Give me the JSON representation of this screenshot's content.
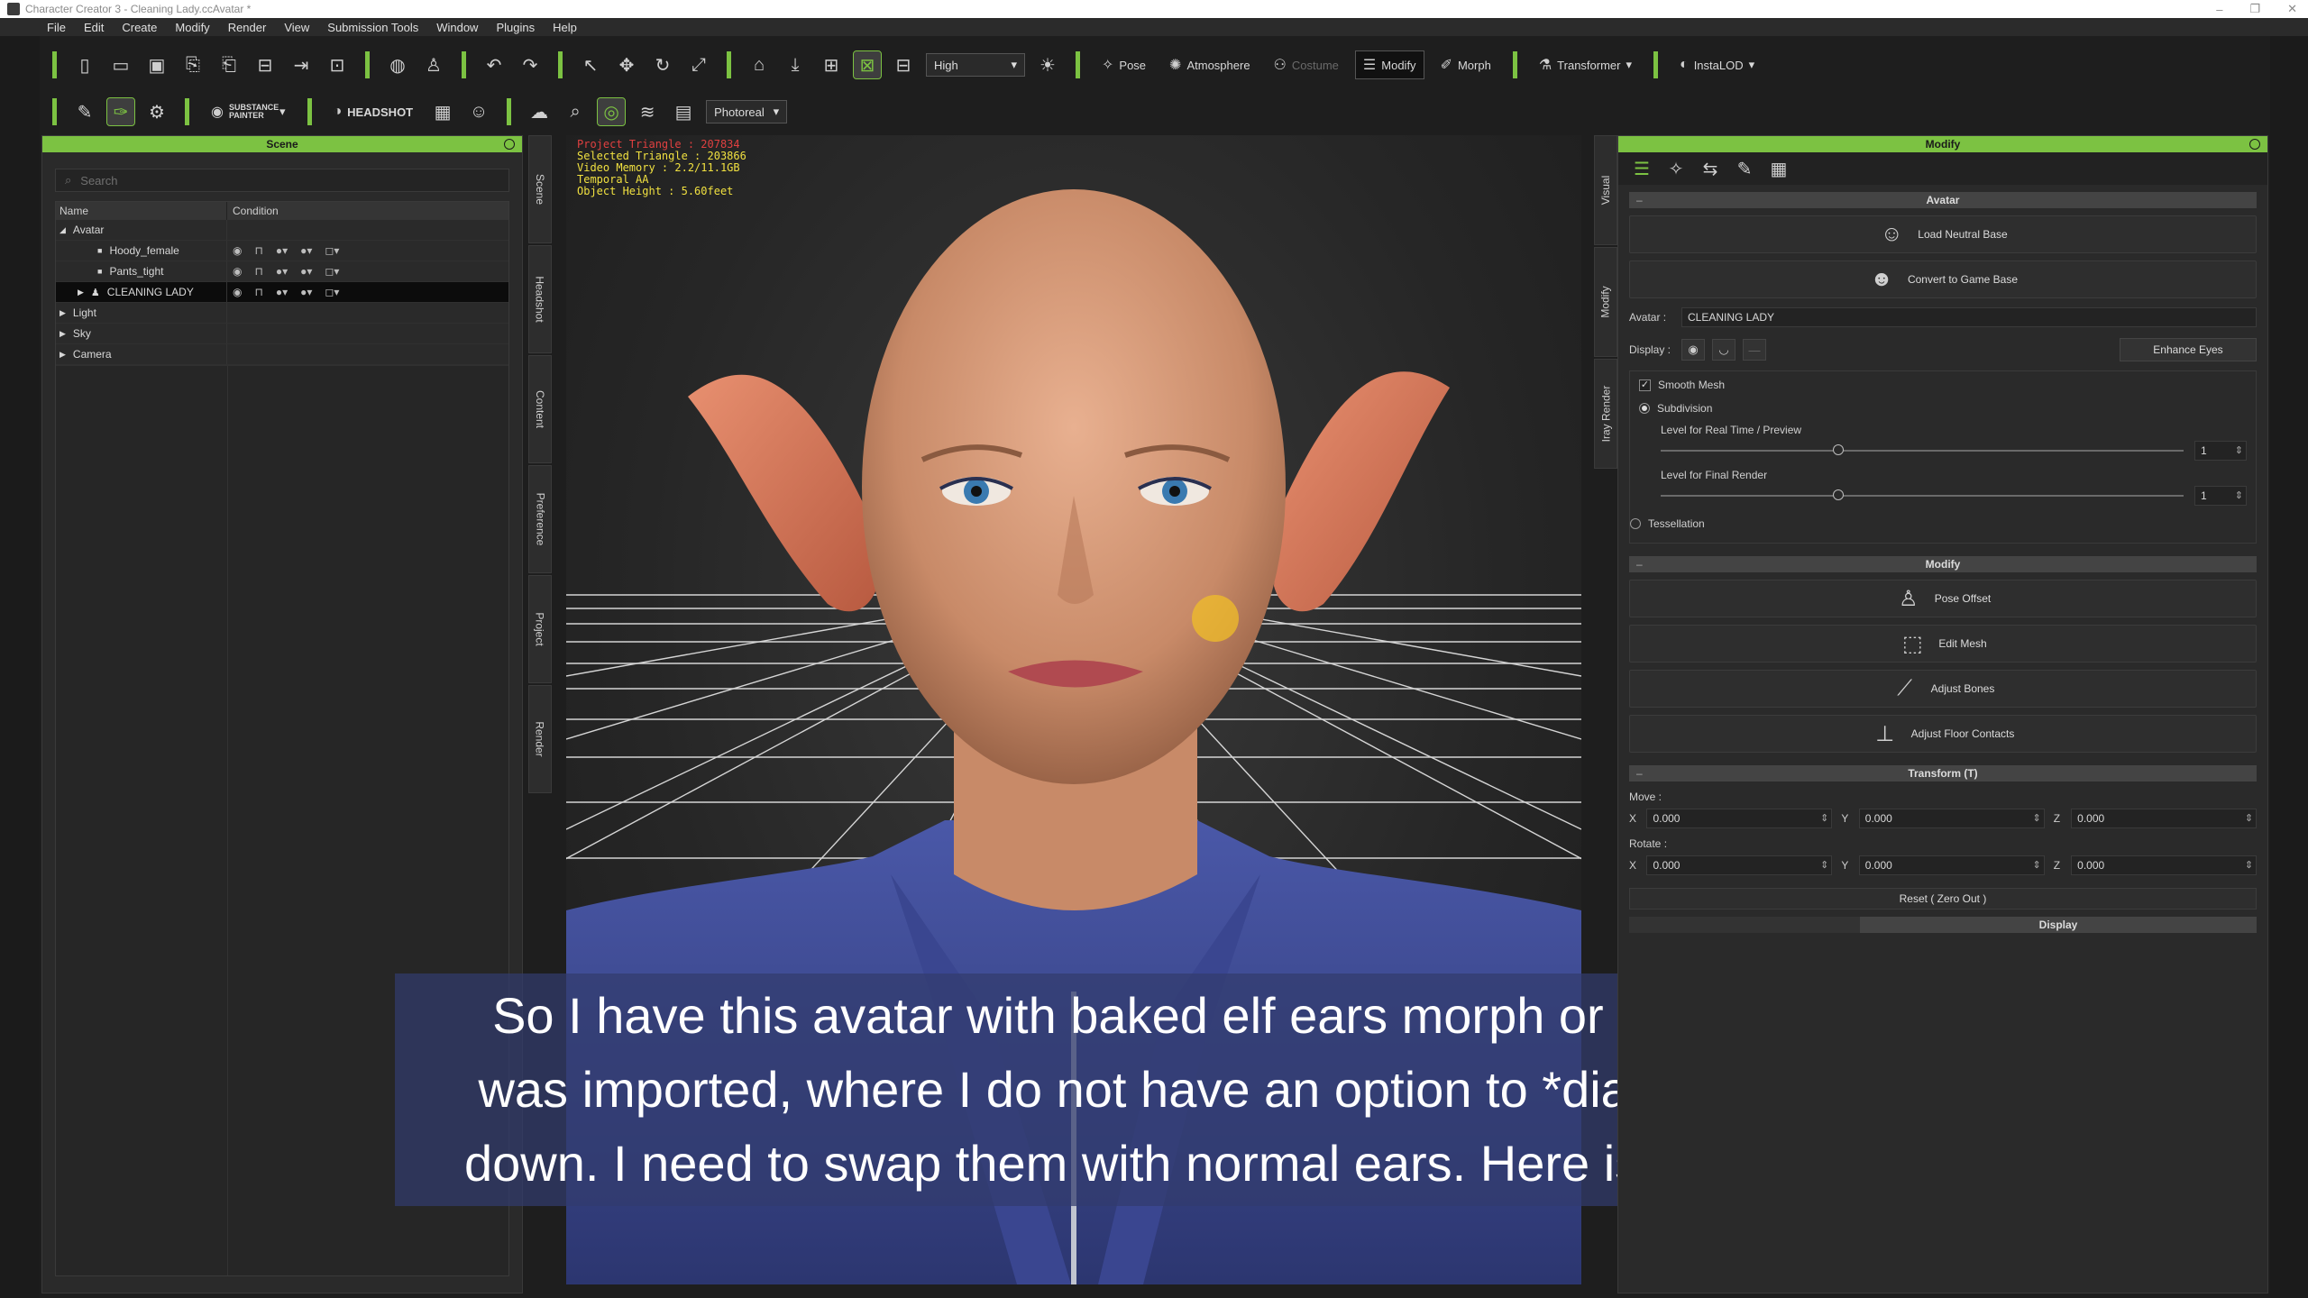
{
  "window": {
    "title": "Character Creator 3 - Cleaning Lady.ccAvatar *"
  },
  "menu": [
    "File",
    "Edit",
    "Create",
    "Modify",
    "Render",
    "View",
    "Submission Tools",
    "Window",
    "Plugins",
    "Help"
  ],
  "toolbar": {
    "quality_select": "High",
    "pose_label": "Pose",
    "atmosphere_label": "Atmosphere",
    "costume_label": "Costume",
    "modify_label": "Modify",
    "morph_label": "Morph",
    "transformer_label": "Transformer",
    "instalod_label": "InstaLOD",
    "substance_label": "SUBSTANCE PAINTER",
    "headshot_label": "HEADSHOT",
    "render_select": "Photoreal"
  },
  "scene": {
    "title": "Scene",
    "search_placeholder": "Search",
    "col_name": "Name",
    "col_condition": "Condition",
    "items": [
      {
        "label": "Avatar"
      },
      {
        "label": "Hoody_female"
      },
      {
        "label": "Pants_tight"
      },
      {
        "label": "CLEANING LADY"
      },
      {
        "label": "Light"
      },
      {
        "label": "Sky"
      },
      {
        "label": "Camera"
      }
    ]
  },
  "left_tabs": [
    "Scene",
    "Headshot",
    "Content",
    "Preference",
    "Project",
    "Render"
  ],
  "right_tabs": [
    "Visual",
    "Modify",
    "Iray Render"
  ],
  "viewport": {
    "stats": {
      "project_triangle": "Project Triangle : 207834",
      "selected_triangle": "Selected Triangle : 203866",
      "video_memory": "Video Memory : 2.2/11.1GB",
      "temporal_aa": "Temporal AA",
      "object_height": "Object Height : 5.60feet"
    }
  },
  "caption": {
    "line1": "So I have this avatar with baked elf ears morph or avatar",
    "line2": "was imported, where I do not have an option to *dial* ears",
    "line3": "down. I need to swap them with normal ears. Here is how..."
  },
  "modify": {
    "title": "Modify",
    "avatar_section": "Avatar",
    "load_neutral_base": "Load Neutral Base",
    "convert_game_base": "Convert to Game Base",
    "avatar_label": "Avatar :",
    "avatar_value": "CLEANING LADY",
    "display_label": "Display :",
    "enhance_eyes": "Enhance Eyes",
    "smooth_mesh": "Smooth Mesh",
    "subdivision": "Subdivision",
    "level_realtime_label": "Level for Real Time / Preview",
    "level_realtime_value": "1",
    "level_final_label": "Level for Final Render",
    "level_final_value": "1",
    "tessellation": "Tessellation",
    "modify_section": "Modify",
    "pose_offset": "Pose Offset",
    "edit_mesh": "Edit Mesh",
    "adjust_bones": "Adjust Bones",
    "adjust_floor": "Adjust Floor Contacts",
    "transform_section": "Transform  (T)",
    "move_label": "Move :",
    "rotate_label": "Rotate :",
    "move": {
      "x": "0.000",
      "y": "0.000",
      "z": "0.000"
    },
    "rotate": {
      "x": "0.000",
      "y": "0.000",
      "z": "0.000"
    },
    "axis": {
      "x": "X",
      "y": "Y",
      "z": "Z"
    },
    "reset_label": "Reset ( Zero Out )",
    "display_section": "Display"
  }
}
